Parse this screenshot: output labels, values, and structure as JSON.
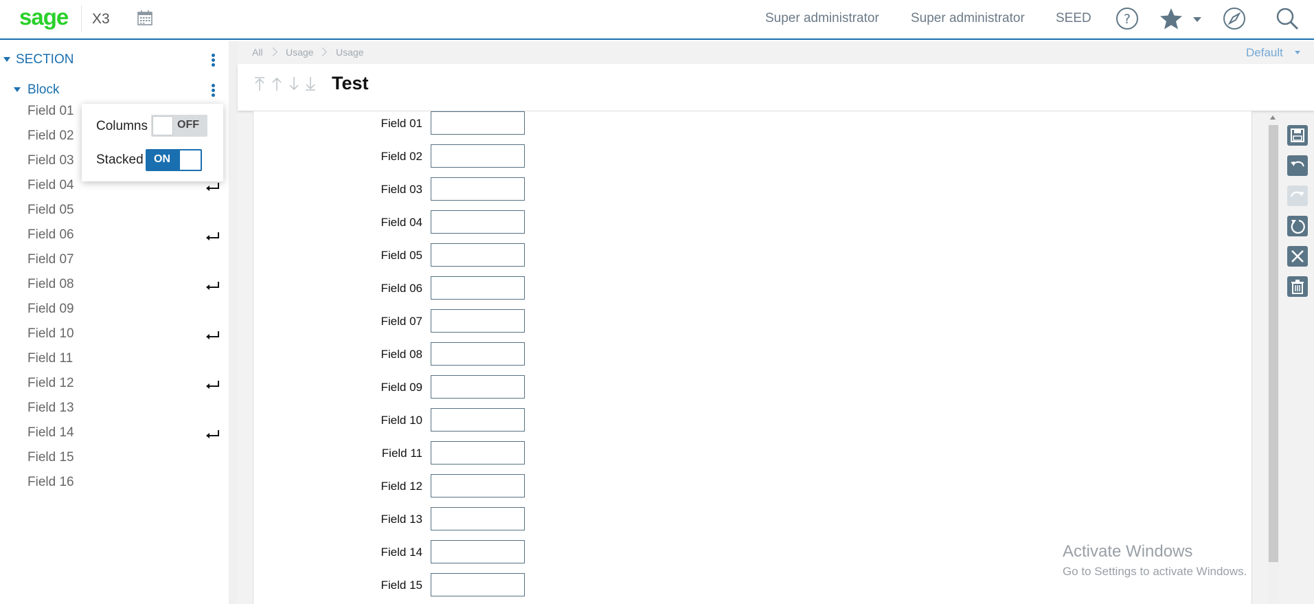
{
  "header": {
    "logo": "sage",
    "app_name": "X3",
    "user_name": "Super administrator",
    "role_name": "Super administrator",
    "folder": "SEED",
    "accent_color": "#1a6fb0",
    "logo_color": "#2ad02a",
    "icons": [
      "calendar-icon",
      "help-icon",
      "star-icon",
      "compass-icon",
      "search-icon"
    ]
  },
  "sidebar": {
    "section_label": "SECTION",
    "block_label": "Block",
    "fields": [
      {
        "label": "Field 01",
        "line_break": false
      },
      {
        "label": "Field 02",
        "line_break": false
      },
      {
        "label": "Field 03",
        "line_break": false
      },
      {
        "label": "Field 04",
        "line_break": true
      },
      {
        "label": "Field 05",
        "line_break": false
      },
      {
        "label": "Field 06",
        "line_break": true
      },
      {
        "label": "Field 07",
        "line_break": false
      },
      {
        "label": "Field 08",
        "line_break": true
      },
      {
        "label": "Field 09",
        "line_break": false
      },
      {
        "label": "Field 10",
        "line_break": true
      },
      {
        "label": "Field 11",
        "line_break": false
      },
      {
        "label": "Field 12",
        "line_break": true
      },
      {
        "label": "Field 13",
        "line_break": false
      },
      {
        "label": "Field 14",
        "line_break": true
      },
      {
        "label": "Field 15",
        "line_break": false
      },
      {
        "label": "Field 16",
        "line_break": false
      }
    ]
  },
  "popup": {
    "columns_label": "Columns",
    "columns_state": "OFF",
    "stacked_label": "Stacked",
    "stacked_state": "ON"
  },
  "breadcrumb": [
    "All",
    "Usage",
    "Usage"
  ],
  "view_selector": "Default",
  "page_title": "Test",
  "form_fields": [
    "Field 01",
    "Field 02",
    "Field 03",
    "Field 04",
    "Field 05",
    "Field 06",
    "Field 07",
    "Field 08",
    "Field 09",
    "Field 10",
    "Field 11",
    "Field 12",
    "Field 13",
    "Field 14",
    "Field 15"
  ],
  "toolbar": [
    "save-icon",
    "undo-icon",
    "redo-icon",
    "refresh-icon",
    "close-icon",
    "delete-icon"
  ],
  "watermark": {
    "line1": "Activate Windows",
    "line2": "Go to Settings to activate Windows."
  }
}
